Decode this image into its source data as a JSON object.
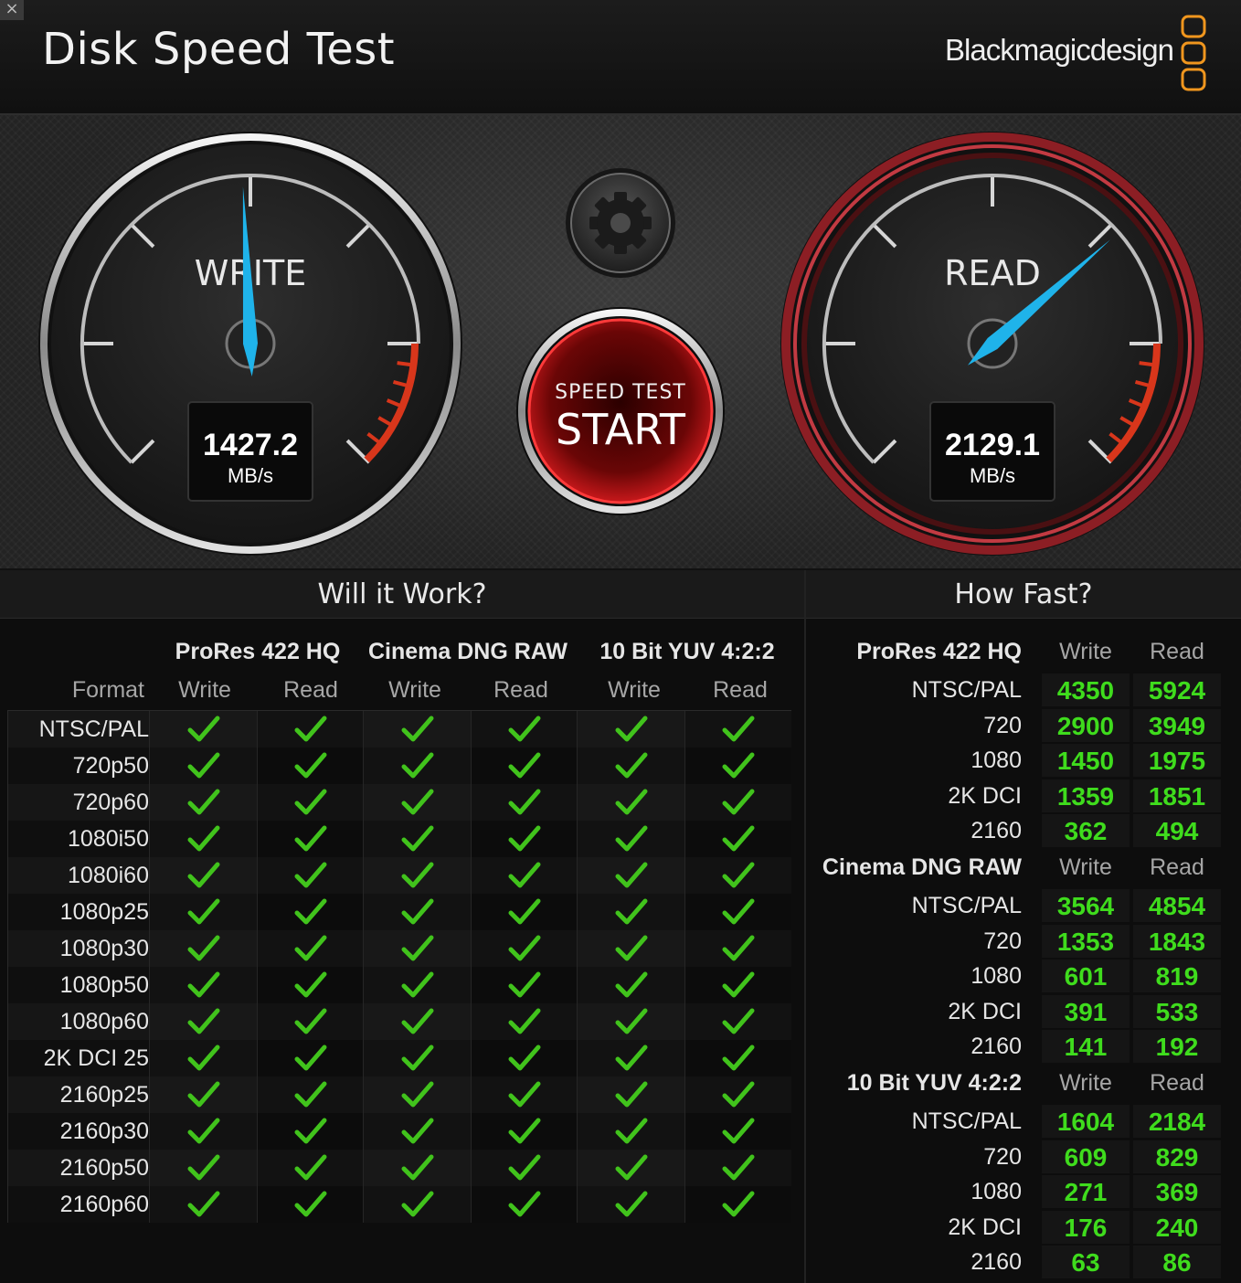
{
  "window": {
    "close_symbol": "×",
    "title": "Disk Speed Test",
    "brand": "Blackmagicdesign"
  },
  "gauges": {
    "write": {
      "label": "WRITE",
      "value": "1427.2",
      "unit": "MB/s",
      "needle_fraction": 0.49
    },
    "read": {
      "label": "READ",
      "value": "2129.1",
      "unit": "MB/s",
      "needle_fraction": 0.68
    }
  },
  "start_button": {
    "line1": "SPEED TEST",
    "line2": "START"
  },
  "icons": {
    "settings": "gear-icon",
    "close": "close-icon",
    "check": "check-icon"
  },
  "colors": {
    "accent_blue": "#1fb3ea",
    "check_green": "#41c31c",
    "value_green": "#3fdc1d",
    "start_red": "#c8181b",
    "logo_orange": "#f0961e"
  },
  "will_it_work": {
    "title": "Will it Work?",
    "format_label": "Format",
    "groups": [
      {
        "name": "ProRes 422 HQ",
        "write": "Write",
        "read": "Read"
      },
      {
        "name": "Cinema DNG RAW",
        "write": "Write",
        "read": "Read"
      },
      {
        "name": "10 Bit YUV 4:2:2",
        "write": "Write",
        "read": "Read"
      }
    ],
    "formats": [
      "NTSC/PAL",
      "720p50",
      "720p60",
      "1080i50",
      "1080i60",
      "1080p25",
      "1080p30",
      "1080p50",
      "1080p60",
      "2K DCI 25",
      "2160p25",
      "2160p30",
      "2160p50",
      "2160p60"
    ],
    "supported": [
      [
        true,
        true,
        true,
        true,
        true,
        true
      ],
      [
        true,
        true,
        true,
        true,
        true,
        true
      ],
      [
        true,
        true,
        true,
        true,
        true,
        true
      ],
      [
        true,
        true,
        true,
        true,
        true,
        true
      ],
      [
        true,
        true,
        true,
        true,
        true,
        true
      ],
      [
        true,
        true,
        true,
        true,
        true,
        true
      ],
      [
        true,
        true,
        true,
        true,
        true,
        true
      ],
      [
        true,
        true,
        true,
        true,
        true,
        true
      ],
      [
        true,
        true,
        true,
        true,
        true,
        true
      ],
      [
        true,
        true,
        true,
        true,
        true,
        true
      ],
      [
        true,
        true,
        true,
        true,
        true,
        true
      ],
      [
        true,
        true,
        true,
        true,
        true,
        true
      ],
      [
        true,
        true,
        true,
        true,
        true,
        true
      ],
      [
        true,
        true,
        true,
        true,
        true,
        true
      ]
    ]
  },
  "how_fast": {
    "title": "How Fast?",
    "groups": [
      {
        "name": "ProRes 422 HQ",
        "write_label": "Write",
        "read_label": "Read",
        "rows": [
          {
            "label": "NTSC/PAL",
            "write": "4350",
            "read": "5924"
          },
          {
            "label": "720",
            "write": "2900",
            "read": "3949"
          },
          {
            "label": "1080",
            "write": "1450",
            "read": "1975"
          },
          {
            "label": "2K DCI",
            "write": "1359",
            "read": "1851"
          },
          {
            "label": "2160",
            "write": "362",
            "read": "494"
          }
        ]
      },
      {
        "name": "Cinema DNG RAW",
        "write_label": "Write",
        "read_label": "Read",
        "rows": [
          {
            "label": "NTSC/PAL",
            "write": "3564",
            "read": "4854"
          },
          {
            "label": "720",
            "write": "1353",
            "read": "1843"
          },
          {
            "label": "1080",
            "write": "601",
            "read": "819"
          },
          {
            "label": "2K DCI",
            "write": "391",
            "read": "533"
          },
          {
            "label": "2160",
            "write": "141",
            "read": "192"
          }
        ]
      },
      {
        "name": "10 Bit YUV 4:2:2",
        "write_label": "Write",
        "read_label": "Read",
        "rows": [
          {
            "label": "NTSC/PAL",
            "write": "1604",
            "read": "2184"
          },
          {
            "label": "720",
            "write": "609",
            "read": "829"
          },
          {
            "label": "1080",
            "write": "271",
            "read": "369"
          },
          {
            "label": "2K DCI",
            "write": "176",
            "read": "240"
          },
          {
            "label": "2160",
            "write": "63",
            "read": "86"
          }
        ]
      }
    ]
  }
}
